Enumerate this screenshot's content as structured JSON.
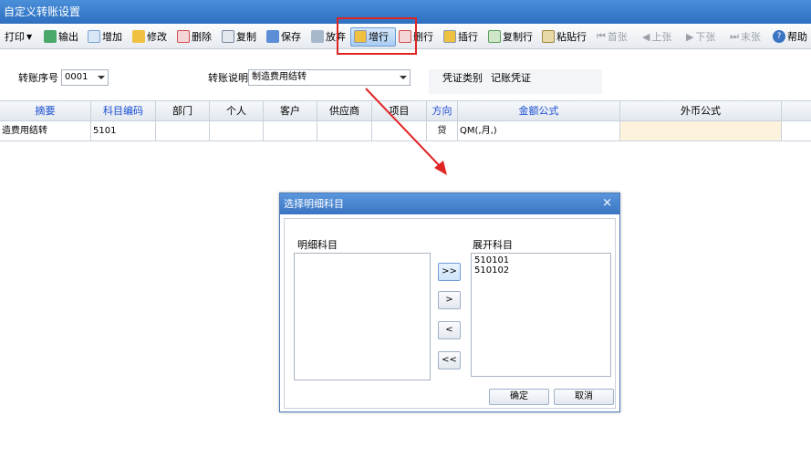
{
  "window": {
    "title": "自定义转账设置"
  },
  "toolbar": {
    "print": "打印",
    "export": "输出",
    "add": "增加",
    "edit": "修改",
    "delete": "删除",
    "copy": "复制",
    "save": "保存",
    "discard": "放弃",
    "add_row": "增行",
    "delete_row": "删行",
    "insert_row": "插行",
    "copy_row": "复制行",
    "paste_row": "粘贴行",
    "first": "首张",
    "prev": "上张",
    "next": "下张",
    "last": "末张",
    "help": "帮助"
  },
  "form": {
    "seq_label": "转账序号",
    "seq_value": "0001",
    "desc_label": "转账说明",
    "desc_value": "制造费用结转",
    "voucher_type_label": "凭证类别",
    "voucher_type_value": "记账凭证"
  },
  "grid": {
    "columns": [
      "摘要",
      "科目编码",
      "部门",
      "个人",
      "客户",
      "供应商",
      "项目",
      "方向",
      "金额公式",
      "外币公式"
    ],
    "rows": [
      {
        "summary": "造费用结转",
        "account_code": "5101",
        "department": "",
        "person": "",
        "customer": "",
        "supplier": "",
        "project": "",
        "direction": "贷",
        "amount_formula": "QM(,月,)",
        "fx_formula": ""
      }
    ]
  },
  "dialog": {
    "title": "选择明细科目",
    "close": "×",
    "left_label": "明细科目",
    "right_label": "展开科目",
    "left_items": [],
    "right_items": [
      "510101",
      "510102"
    ],
    "btn_all_right": ">>",
    "btn_right": ">",
    "btn_left": "<",
    "btn_all_left": "<<",
    "ok": "确定",
    "cancel": "取消"
  },
  "colors": {
    "accent": "#2e6fc1",
    "highlight_box": "#e02424",
    "header_blue_text": "#1a4fd3",
    "fx_cell": "#fdf3dc"
  }
}
